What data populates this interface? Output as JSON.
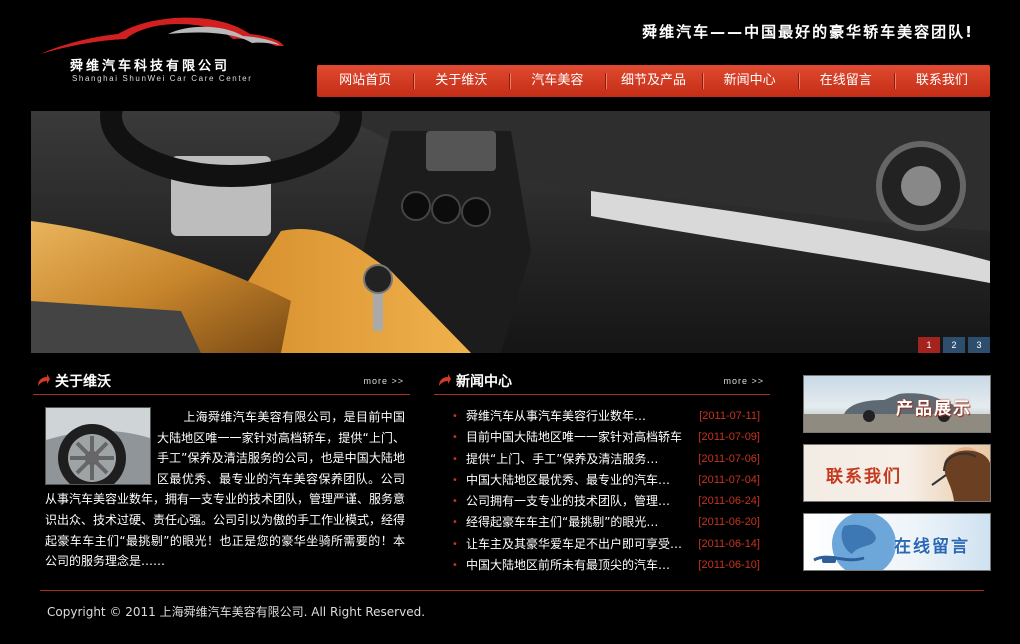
{
  "brand": {
    "name_cn": "舜维汽车科技有限公司",
    "name_en": "Shanghai ShunWei Car Care Center",
    "slogan": "舜维汽车——中国最好的豪华轿车美容团队!"
  },
  "nav": {
    "items": [
      "网站首页",
      "关于维沃",
      "汽车美容",
      "细节及产品",
      "新闻中心",
      "在线留言",
      "联系我们"
    ]
  },
  "banner": {
    "slides": [
      "1",
      "2",
      "3"
    ],
    "active_slide": 1
  },
  "about": {
    "title": "关于维沃",
    "more": "more",
    "text": "上海舜维汽车美容有限公司，是目前中国大陆地区唯一一家针对高档轿车，提供“上门、手工”保养及清洁服务的公司，也是中国大陆地区最优秀、最专业的汽车美容保养团队。公司从事汽车美容业数年，拥有一支专业的技术团队，管理严谨、服务意识出众、技术过硬、责任心强。公司引以为傲的手工作业模式，经得起豪车车主们“最挑剔”的眼光！也正是您的豪华坐骑所需要的！本公司的服务理念是……"
  },
  "news": {
    "title": "新闻中心",
    "more": "more",
    "items": [
      {
        "title": "舜维汽车从事汽车美容行业数年…",
        "date": "[2011-07-11]"
      },
      {
        "title": "目前中国大陆地区唯一一家针对高档轿车",
        "date": "[2011-07-09]"
      },
      {
        "title": "提供“上门、手工”保养及清洁服务…",
        "date": "[2011-07-06]"
      },
      {
        "title": "中国大陆地区最优秀、最专业的汽车…",
        "date": "[2011-07-04]"
      },
      {
        "title": "公司拥有一支专业的技术团队，管理…",
        "date": "[2011-06-24]"
      },
      {
        "title": "经得起豪车车主们“最挑剔”的眼光…",
        "date": "[2011-06-20]"
      },
      {
        "title": "让车主及其豪华爱车足不出户即可享受…",
        "date": "[2011-06-14]"
      },
      {
        "title": "中国大陆地区前所未有最顶尖的汽车…",
        "date": "[2011-06-10]"
      }
    ]
  },
  "sidebar": {
    "products": "产品展示",
    "contact": "联系我们",
    "message": "在线留言"
  },
  "footer": {
    "copyright": "Copyright © 2011 上海舜维汽车美容有限公司. All Right Reserved."
  },
  "colors": {
    "accent": "#c7331d",
    "nav": "#d23b22",
    "slider_active": "#a3231e",
    "slider_inactive": "#2d4e6c"
  }
}
